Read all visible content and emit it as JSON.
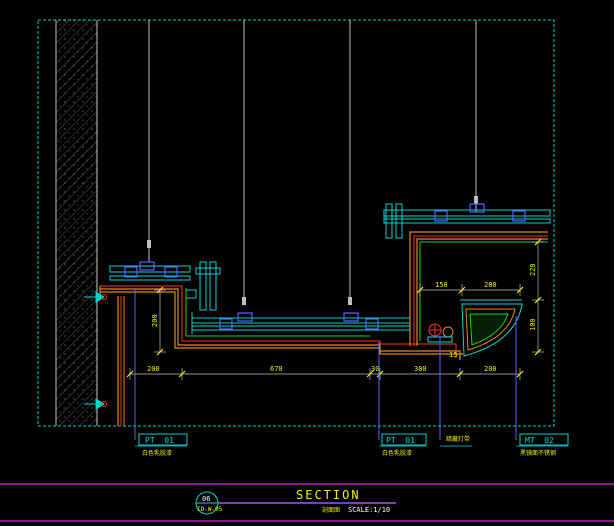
{
  "colors": {
    "background": "#000000",
    "frame": "#00d5d5",
    "wall": "#bfbfbf",
    "hatch": "#7a7a7a",
    "orange": "#e08a1e",
    "red": "#ff3030",
    "green": "#1fd11f",
    "cyan": "#00d5d5",
    "blue": "#5a64ff",
    "yellow": "#f0f000",
    "white": "#ffffff",
    "magenta": "#ff33ff",
    "violet": "#b04cff"
  },
  "dimensions": {
    "d200_left": "200",
    "d670": "670",
    "d30": "30",
    "d300": "300",
    "d200_right": "200",
    "d200_vertical": "200",
    "d150": "150",
    "d200_upper": "200",
    "d220": "220",
    "d100": "100",
    "d15": "15"
  },
  "callouts": [
    {
      "code": "PT  01",
      "note": "白色乳胶漆"
    },
    {
      "code": "PT  01",
      "note": "白色乳胶漆"
    },
    {
      "code": "",
      "note": "暗藏灯带"
    },
    {
      "code": "MT  02",
      "note": "黑镜面不锈钢"
    }
  ],
  "title_block": {
    "number": "06",
    "sheet": "ID-W-05",
    "title": "SECTION",
    "subtitle": "剖面图",
    "scale": "SCALE:1/10"
  }
}
